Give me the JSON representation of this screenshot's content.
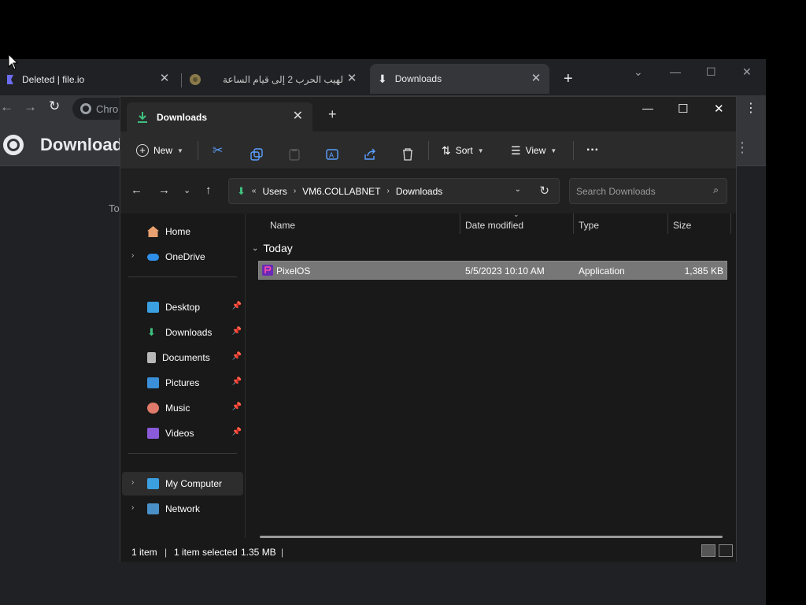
{
  "chrome": {
    "tabs": [
      {
        "label": "Deleted | file.io",
        "close": "✕"
      },
      {
        "label": "لهيب الحرب 2 إلى قيام الساعة",
        "close": "✕"
      },
      {
        "label": "Downloads",
        "close": "✕"
      }
    ],
    "omnibox_text": "Chro",
    "page_title": "Download",
    "today_label": "To"
  },
  "explorer": {
    "tab_title": "Downloads",
    "toolbar": {
      "new_label": "New",
      "sort_label": "Sort",
      "view_label": "View",
      "more_label": "···"
    },
    "address": {
      "segments": [
        "Users",
        "VM6.COLLABNET",
        "Downloads"
      ]
    },
    "search_placeholder": "Search Downloads",
    "sidebar": {
      "home": "Home",
      "onedrive": "OneDrive",
      "desktop": "Desktop",
      "downloads": "Downloads",
      "documents": "Documents",
      "pictures": "Pictures",
      "music": "Music",
      "videos": "Videos",
      "my_computer": "My Computer",
      "network": "Network"
    },
    "columns": {
      "name": "Name",
      "date": "Date modified",
      "type": "Type",
      "size": "Size"
    },
    "group_label": "Today",
    "files": [
      {
        "name": "PixelOS",
        "date": "5/5/2023 10:10 AM",
        "type": "Application",
        "size": "1,385 KB"
      }
    ],
    "status": {
      "count": "1 item",
      "selected": "1 item selected",
      "size": "1.35 MB"
    }
  },
  "colors": {
    "accent_download": "#3fbf7f",
    "selection_row": "#777777"
  }
}
